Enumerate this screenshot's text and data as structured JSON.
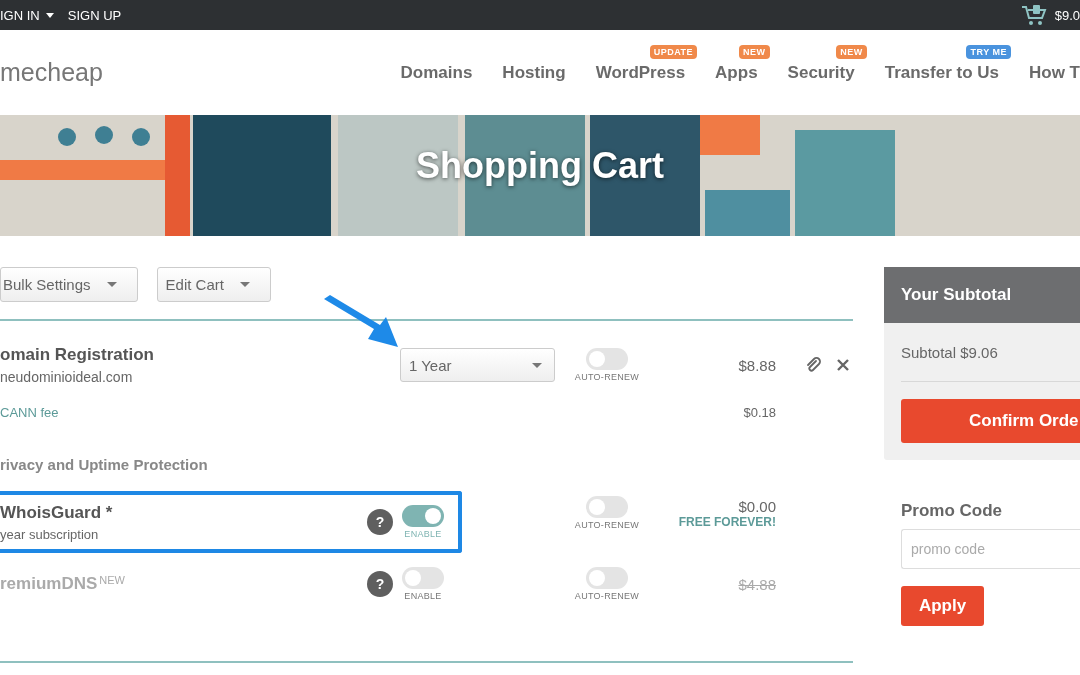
{
  "top_bar": {
    "links": [
      {
        "label": "IGN IN",
        "dropdown": true
      },
      {
        "label": "SIGN UP",
        "dropdown": false
      }
    ],
    "cart_total": "$9.0"
  },
  "header": {
    "logo": "mecheap",
    "nav": [
      {
        "label": "Domains"
      },
      {
        "label": "Hosting"
      },
      {
        "label": "WordPress",
        "badge": {
          "text": "UPDATE",
          "color": "#f0894a"
        }
      },
      {
        "label": "Apps",
        "badge": {
          "text": "NEW",
          "color": "#f0894a"
        }
      },
      {
        "label": "Security",
        "badge": {
          "text": "NEW",
          "color": "#f0894a"
        }
      },
      {
        "label": "Transfer to Us",
        "badge": {
          "text": "TRY ME",
          "color": "#4a93de"
        }
      },
      {
        "label": "How T"
      }
    ]
  },
  "banner": {
    "title": "Shopping Cart"
  },
  "toolbar": [
    "Bulk Settings",
    "Edit Cart"
  ],
  "cart": {
    "domain": {
      "title": "omain Registration",
      "name": "neudominioideal.com",
      "period": "1 Year",
      "auto_renew": {
        "label": "AUTO-RENEW",
        "on": false
      },
      "price": "$8.88"
    },
    "fee": {
      "label": "CANN fee",
      "price": "$0.18"
    },
    "section": "rivacy and Uptime Protection",
    "addons": [
      {
        "name": "WhoisGuard *",
        "subtitle": "year subscription",
        "highlighted": true,
        "help": "?",
        "enable": {
          "label": "ENABLE",
          "on": true
        },
        "auto_renew": {
          "label": "AUTO-RENEW",
          "on": false
        },
        "price": "$0.00",
        "note": "FREE FOREVER!"
      },
      {
        "name": "remiumDNS",
        "badge": "NEW",
        "highlighted": false,
        "help": "?",
        "enable": {
          "label": "ENABLE",
          "on": false
        },
        "auto_renew": {
          "label": "AUTO-RENEW",
          "on": false
        },
        "price": "$4.88"
      }
    ]
  },
  "summary": {
    "title": "Your Subtotal",
    "subtotal": "Subtotal $9.06",
    "confirm": "Confirm Orde"
  },
  "promo": {
    "heading": "Promo Code",
    "placeholder": "promo code",
    "apply": "Apply"
  }
}
